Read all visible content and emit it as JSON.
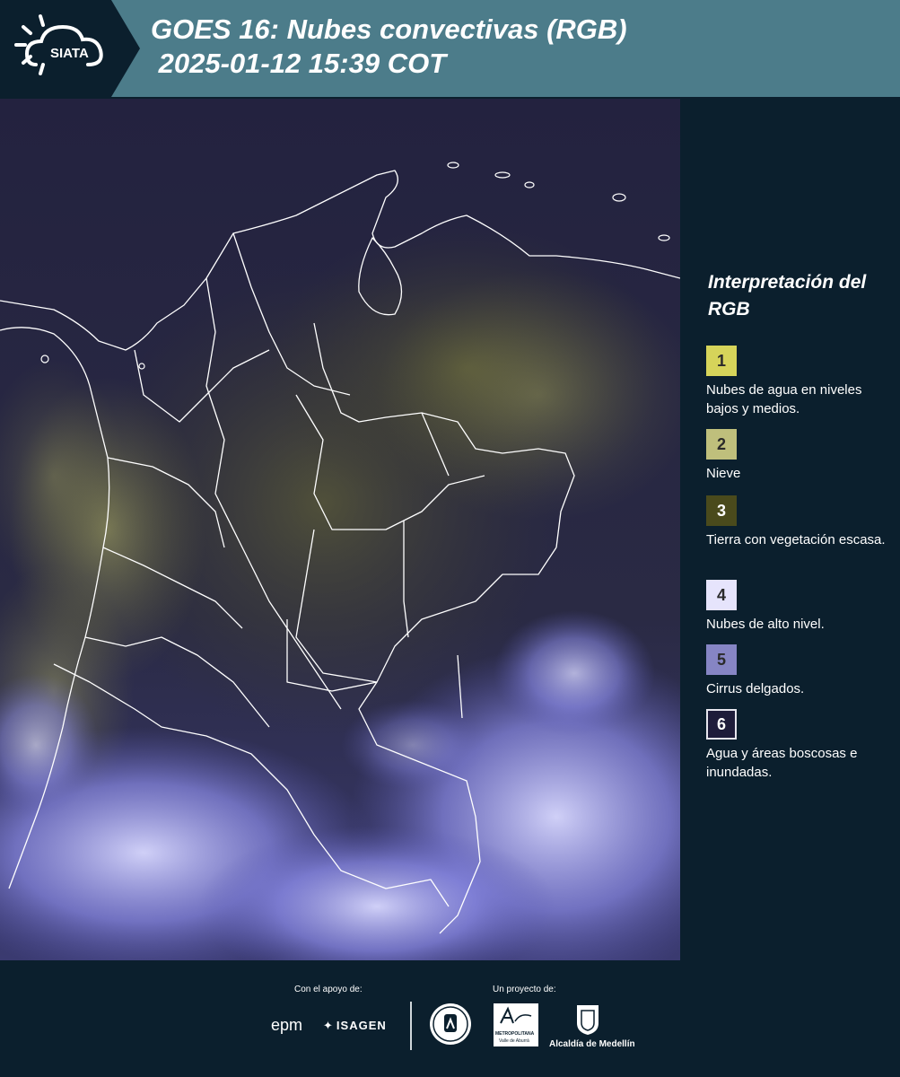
{
  "header": {
    "logo_text": "SIATA",
    "title_line1": "GOES 16: Nubes convectivas (RGB)",
    "title_line2": " 2025-01-12 15:39 COT"
  },
  "legend": {
    "title": "Interpretación del RGB",
    "items": [
      {
        "number": "1",
        "label": "Nubes de agua en niveles bajos y medios.",
        "color": "#d6d45a"
      },
      {
        "number": "2",
        "label": "Nieve",
        "color": "#bfbf7c"
      },
      {
        "number": "3",
        "label": "Tierra con vegetación escasa.",
        "color": "#4a4a1c"
      },
      {
        "number": "4",
        "label": "Nubes de alto nivel.",
        "color": "#e6e4fc"
      },
      {
        "number": "5",
        "label": "Cirrus delgados.",
        "color": "#8685c4"
      },
      {
        "number": "6",
        "label": "Agua y áreas boscosas e inundadas.",
        "color": "#1e1c3a"
      }
    ]
  },
  "footer": {
    "support_label": "Con el apoyo de:",
    "project_label": "Un proyecto de:",
    "sponsor1": "epm",
    "sponsor2": "ISAGEN",
    "partner1_line1": "METROPOLITANA",
    "partner1_line2": "Valle de Aburrá",
    "partner2": "Alcaldía de Medellín"
  }
}
